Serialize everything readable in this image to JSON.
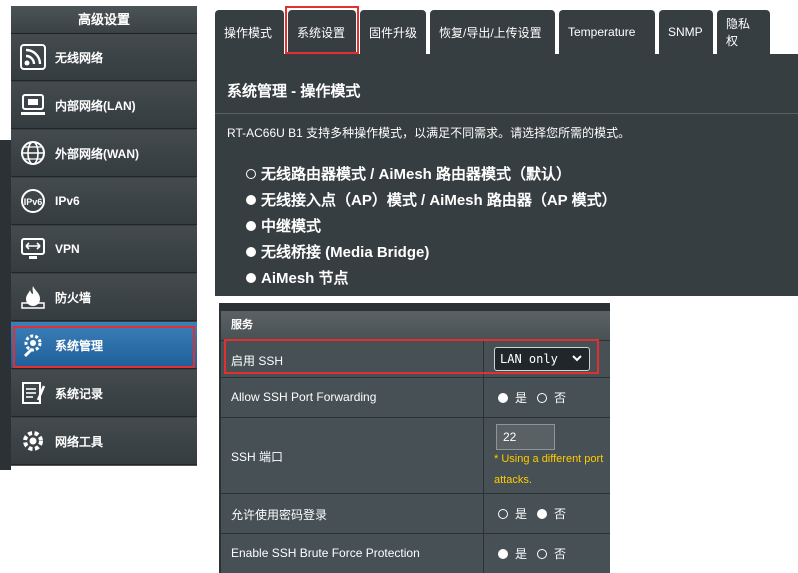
{
  "sidebar": {
    "title": "高级设置",
    "items": [
      {
        "label": "无线网络",
        "icon": "wireless-icon"
      },
      {
        "label": "内部网络(LAN)",
        "icon": "lan-icon"
      },
      {
        "label": "外部网络(WAN)",
        "icon": "globe-icon"
      },
      {
        "label": "IPv6",
        "icon": "ipv6-icon"
      },
      {
        "label": "VPN",
        "icon": "vpn-icon"
      },
      {
        "label": "防火墙",
        "icon": "firewall-icon"
      },
      {
        "label": "系统管理",
        "icon": "gear-wrench-icon",
        "active": true
      },
      {
        "label": "系统记录",
        "icon": "log-icon"
      },
      {
        "label": "网络工具",
        "icon": "tools-icon"
      }
    ]
  },
  "tabs": [
    {
      "label": "操作模式"
    },
    {
      "label": "系统设置",
      "highlighted": true
    },
    {
      "label": "固件升级"
    },
    {
      "label": "恢复/导出/上传设置"
    },
    {
      "label": "Temperature"
    },
    {
      "label": "SNMP"
    },
    {
      "label": "隐私权"
    }
  ],
  "main": {
    "title": "系统管理 - 操作模式",
    "description": "RT-AC66U B1 支持多种操作模式，以满足不同需求。请选择您所需的模式。",
    "modes": [
      {
        "label": "无线路由器模式 / AiMesh 路由器模式（默认）",
        "selected": true
      },
      {
        "label": "无线接入点（AP）模式 / AiMesh 路由器（AP 模式）",
        "selected": false
      },
      {
        "label": "中继模式",
        "selected": false
      },
      {
        "label": "无线桥接 (Media Bridge)",
        "selected": false
      },
      {
        "label": "AiMesh 节点",
        "selected": false
      }
    ]
  },
  "services": {
    "header": "服务",
    "enable_ssh": {
      "label": "启用 SSH",
      "value": "LAN only"
    },
    "port_forwarding": {
      "label": "Allow SSH Port Forwarding",
      "yes": "是",
      "no": "否",
      "selected": "no"
    },
    "ssh_port": {
      "label": "SSH 端口",
      "value": "22",
      "warning_line1": "* Using a different port",
      "warning_line2": "attacks."
    },
    "password_login": {
      "label": "允许使用密码登录",
      "yes": "是",
      "no": "否",
      "selected": "no"
    },
    "brute_force": {
      "label": "Enable SSH Brute Force Protection",
      "yes": "是",
      "no": "否",
      "selected": "no"
    }
  },
  "colors": {
    "panel_bg": "#373e41",
    "active_blue": "#1e5f99",
    "highlight_red": "#e03030",
    "warning_yellow": "#ffcc00"
  }
}
